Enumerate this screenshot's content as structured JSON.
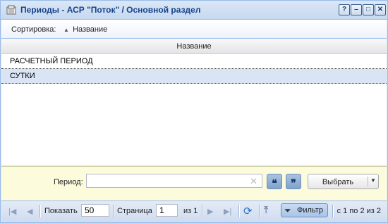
{
  "window": {
    "title": "Периоды - АСР \"Поток\" / Основной раздел",
    "tools": [
      "?",
      "–",
      "□",
      "✕"
    ]
  },
  "sortbar": {
    "label": "Сортировка:",
    "item": "Название"
  },
  "grid": {
    "column": "Название",
    "rows": [
      "РАСЧЕТНЫЙ ПЕРИОД",
      "СУТКИ"
    ]
  },
  "filter": {
    "label": "Период:",
    "value": "",
    "quote_open": "❝",
    "quote_close": "❞",
    "select_label": "Выбрать"
  },
  "paging": {
    "show_label": "Показать",
    "page_size": "50",
    "page_label": "Страница",
    "page": "1",
    "of_pages": "из 1",
    "filter_label": "Фильтр",
    "info": "с 1 по 2 из 2"
  },
  "colors": {
    "accent": "#15428b",
    "selected_row": "#d9e5f4",
    "filter_panel": "#fcfcdc"
  }
}
